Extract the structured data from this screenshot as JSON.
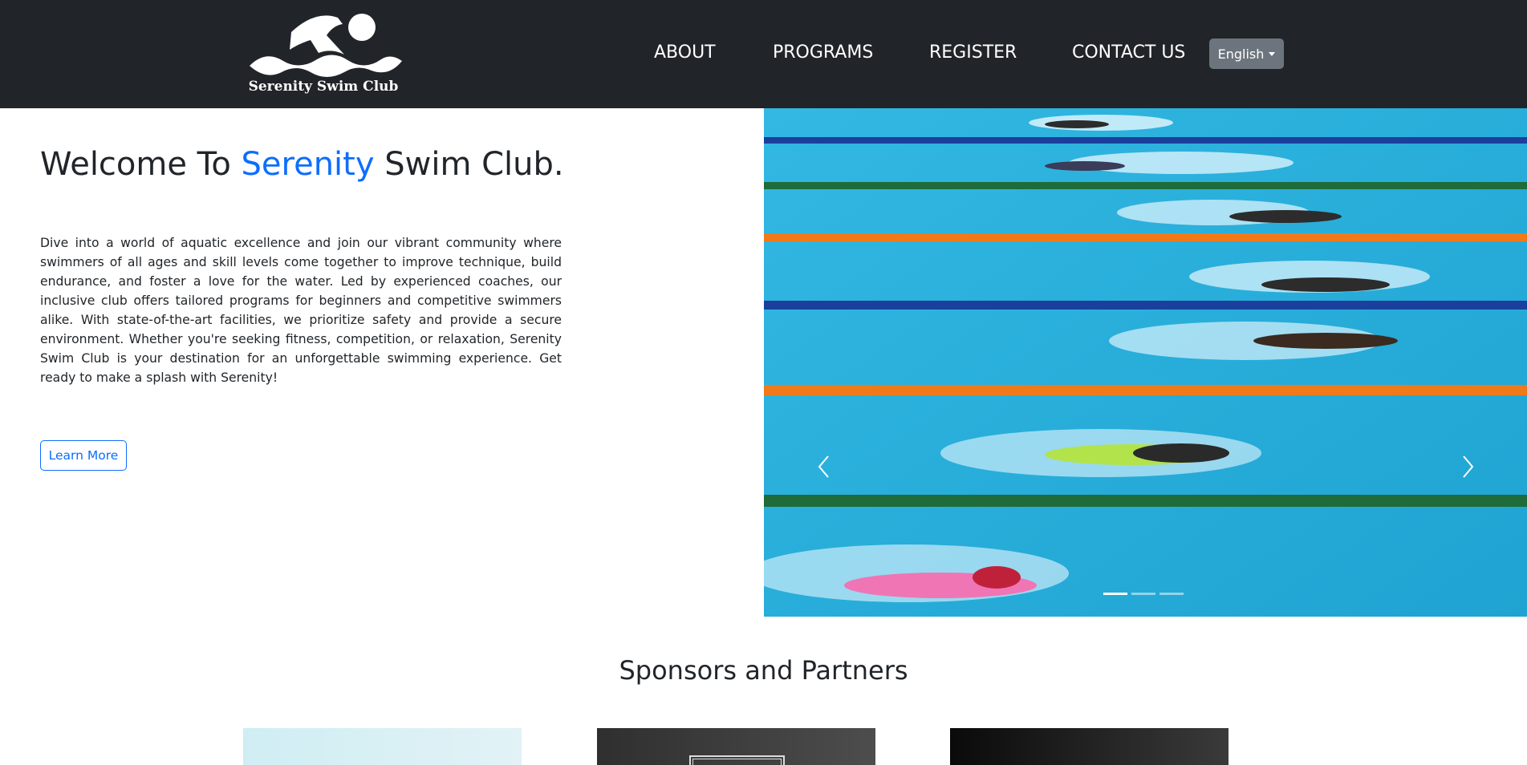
{
  "brand": {
    "name": "Serenity Swim Club",
    "logo_icon": "swimmer-logo-icon"
  },
  "nav": {
    "items": [
      {
        "label": "ABOUT"
      },
      {
        "label": "PROGRAMS"
      },
      {
        "label": "REGISTER"
      },
      {
        "label": "CONTACT US"
      }
    ],
    "language": {
      "selected": "English"
    }
  },
  "hero": {
    "title_prefix": "Welcome To ",
    "title_accent": "Serenity",
    "title_suffix": " Swim Club.",
    "body": "Dive into a world of aquatic excellence and join our vibrant community where swimmers of all ages and skill levels come together to improve technique, build endurance, and foster a love for the water. Led by experienced coaches, our inclusive club offers tailored programs for beginners and competitive swimmers alike. With state-of-the-art facilities, we prioritize safety and provide a secure environment. Whether you're seeking fitness, competition, or relaxation, Serenity Swim Club is your destination for an unforgettable swimming experience. Get ready to make a splash with Serenity!",
    "cta_label": "Learn More"
  },
  "carousel": {
    "slide_count": 3,
    "active_slide": 1,
    "image": "swimmers-racing-in-pool-photo",
    "prev_icon": "chevron-left-icon",
    "next_icon": "chevron-right-icon"
  },
  "sponsors": {
    "title": "Sponsors and Partners",
    "count": 3
  },
  "colors": {
    "navbar_bg": "#212529",
    "accent": "#0d6efd",
    "language_button": "#6c757d",
    "pool_water": "#2fb0db"
  }
}
